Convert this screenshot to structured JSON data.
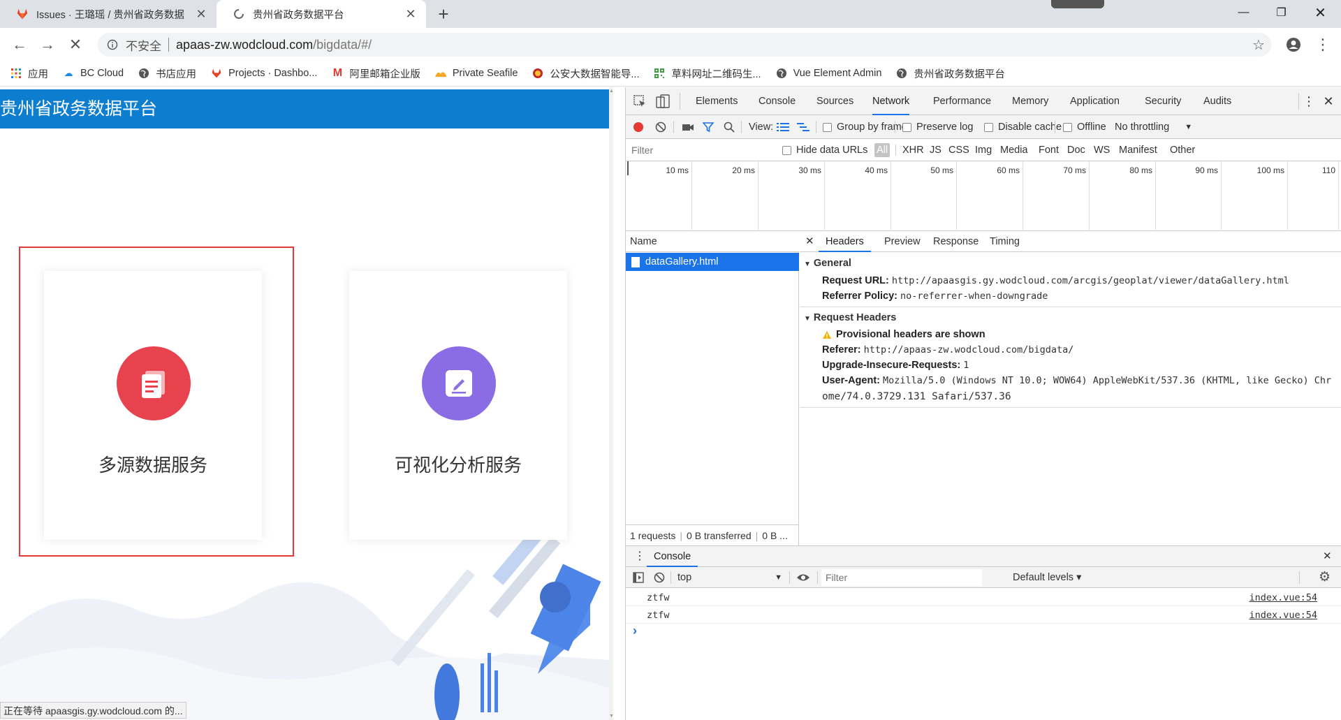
{
  "browser": {
    "tabs": [
      {
        "title": "Issues · 王璐瑶 / 贵州省政务数据",
        "icon": "gitlab-icon",
        "active": false
      },
      {
        "title": "贵州省政务数据平台",
        "icon": "loading-spinner-icon",
        "active": true
      }
    ],
    "address": {
      "security_label": "不安全",
      "host": "apaas-zw.wodcloud.com",
      "path": "/bigdata/#/"
    },
    "bookmarks": [
      {
        "label": "应用",
        "icon": "apps-grid-icon"
      },
      {
        "label": "BC Cloud",
        "icon": "cloud-icon"
      },
      {
        "label": "书店应用",
        "icon": "globe-icon"
      },
      {
        "label": "Projects · Dashbo...",
        "icon": "gitlab-icon"
      },
      {
        "label": "阿里邮箱企业版",
        "icon": "mail-m-icon"
      },
      {
        "label": "Private Seafile",
        "icon": "seafile-icon"
      },
      {
        "label": "公安大数据智能导...",
        "icon": "police-badge-icon"
      },
      {
        "label": "草料网址二维码生...",
        "icon": "qrcode-icon"
      },
      {
        "label": "Vue Element Admin",
        "icon": "globe-icon"
      },
      {
        "label": "贵州省政务数据平台",
        "icon": "globe-icon"
      }
    ]
  },
  "page": {
    "banner_title": "贵州省政务数据平台",
    "cards": [
      {
        "label": "多源数据服务",
        "icon": "document-stack-icon",
        "color": "#e8424f"
      },
      {
        "label": "可视化分析服务",
        "icon": "edit-pen-icon",
        "color": "#8a6ce4"
      }
    ],
    "status_text": "正在等待 apaasgis.gy.wodcloud.com 的..."
  },
  "devtools": {
    "tabs": [
      "Elements",
      "Console",
      "Sources",
      "Network",
      "Performance",
      "Memory",
      "Application",
      "Security",
      "Audits"
    ],
    "active_tab": "Network",
    "network_toolbar": {
      "view_label": "View:",
      "group_by_frame": "Group by frame",
      "preserve_log": "Preserve log",
      "disable_cache": "Disable cache",
      "offline": "Offline",
      "throttling": "No throttling"
    },
    "filter": {
      "placeholder": "Filter",
      "hide_data_urls": "Hide data URLs",
      "types": [
        "All",
        "XHR",
        "JS",
        "CSS",
        "Img",
        "Media",
        "Font",
        "Doc",
        "WS",
        "Manifest",
        "Other"
      ]
    },
    "timeline_ticks": [
      "10 ms",
      "20 ms",
      "30 ms",
      "40 ms",
      "50 ms",
      "60 ms",
      "70 ms",
      "80 ms",
      "90 ms",
      "100 ms",
      "110"
    ],
    "requests": {
      "column_name": "Name",
      "items": [
        "dataGallery.html"
      ],
      "summary": [
        "1 requests",
        "0 B transferred",
        "0 B ..."
      ]
    },
    "detail_tabs": [
      "Headers",
      "Preview",
      "Response",
      "Timing"
    ],
    "general": {
      "title": "General",
      "request_url_label": "Request URL:",
      "request_url": "http://apaasgis.gy.wodcloud.com/arcgis/geoplat/viewer/dataGallery.html",
      "referrer_policy_label": "Referrer Policy:",
      "referrer_policy": "no-referrer-when-downgrade"
    },
    "request_headers": {
      "title": "Request Headers",
      "warning": "Provisional headers are shown",
      "referer_label": "Referer:",
      "referer": "http://apaas-zw.wodcloud.com/bigdata/",
      "uir_label": "Upgrade-Insecure-Requests:",
      "uir": "1",
      "ua_label": "User-Agent:",
      "ua_line1": "Mozilla/5.0 (Windows NT 10.0; WOW64) AppleWebKit/537.36 (KHTML, like Gecko) Chr",
      "ua_line2": "ome/74.0.3729.131 Safari/537.36"
    },
    "console": {
      "title": "Console",
      "context": "top",
      "filter_placeholder": "Filter",
      "levels": "Default levels ▾",
      "messages": [
        {
          "text": "ztfw",
          "source": "index.vue:54"
        },
        {
          "text": "ztfw",
          "source": "index.vue:54"
        }
      ],
      "prompt": "›"
    }
  }
}
